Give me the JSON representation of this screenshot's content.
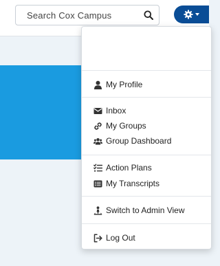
{
  "search": {
    "placeholder": "Search Cox Campus"
  },
  "menu": {
    "profile": "My Profile",
    "inbox": "Inbox",
    "groups": "My Groups",
    "group_dashboard": "Group Dashboard",
    "action_plans": "Action Plans",
    "transcripts": "My Transcripts",
    "admin_view": "Switch to Admin View",
    "logout": "Log Out"
  },
  "colors": {
    "accent": "#0a4d96",
    "banner": "#1a9be0",
    "page_bg": "#edf3f8"
  }
}
